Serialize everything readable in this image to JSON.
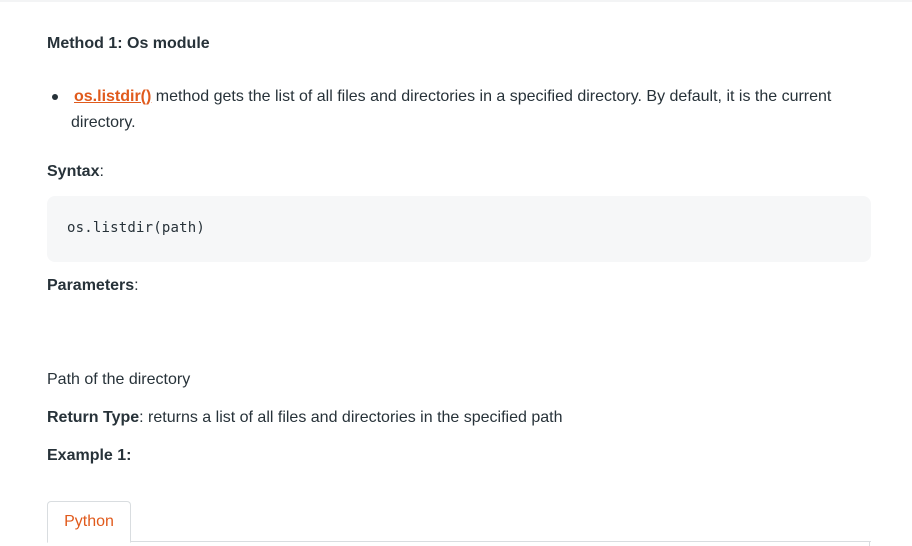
{
  "heading": "Method 1: Os module",
  "bullet": {
    "link_text": "os.listdir()",
    "text": " method gets the list of all files and directories in a specified directory. By default, it is the current directory."
  },
  "syntax": {
    "label": "Syntax",
    "suffix": ":",
    "code": "os.listdir(path)"
  },
  "parameters": {
    "label": "Parameters",
    "suffix": ":"
  },
  "path_description": "Path of the directory",
  "return_type": {
    "label": "Return Type",
    "text": ": returns a list of all files and directories in the specified path"
  },
  "example": {
    "label": "Example 1:"
  },
  "tabs": [
    {
      "label": "Python",
      "active": true
    }
  ],
  "colors": {
    "accent": "#e05a1c",
    "text": "#273239",
    "code_bg": "#f6f7f8",
    "border": "#d9dde0"
  }
}
